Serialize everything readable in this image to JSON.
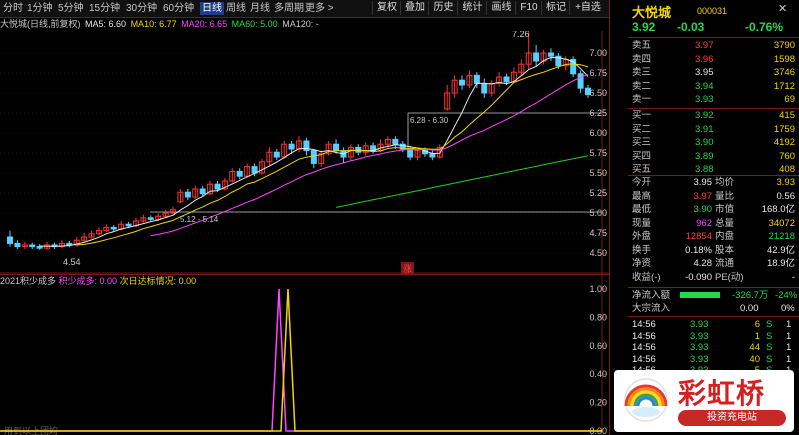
{
  "toolbar": {
    "periods": [
      "分时",
      "1分钟",
      "5分钟",
      "15分钟",
      "30分钟",
      "60分钟",
      "日线",
      "周线",
      "月线",
      "多周期",
      "更多 >"
    ],
    "buttons": [
      "复权",
      "叠加",
      "历史",
      "统计",
      "画线",
      "F10",
      "标记",
      "+自选"
    ]
  },
  "header": {
    "title": "大悦城(日线,前复权)",
    "ma5": "MA5: 6.60",
    "ma10": "MA10: 6.77",
    "ma20": "MA20: 6.65",
    "ma60": "MA60: 5.00",
    "ma120": "MA120: -"
  },
  "chart": {
    "price_labels": [
      "7.00",
      "6.75",
      "6.50",
      "6.25",
      "6.00",
      "5.75",
      "5.50",
      "5.25",
      "5.00",
      "4.75",
      "4.50"
    ],
    "ann_high": "7.26",
    "ann_low": "4.54",
    "ann_box1": "5.12 - 5.14",
    "ann_box2": "6.28 - 6.30",
    "marker": "涨",
    "ind_labels": [
      "1.00",
      "0.80",
      "0.60",
      "0.40",
      "0.20"
    ],
    "ind_low_label": "0.00",
    "watermark": "用到以上团均"
  },
  "indicator": {
    "name": "2021积少成多",
    "line1": "积少成多: 0.00",
    "line2": "次日达标情况: 0.00"
  },
  "stock": {
    "name": "大悦城",
    "code": "000031",
    "price": "3.92",
    "change": "-0.03",
    "pct": "-0.76%"
  },
  "asks": [
    {
      "label": "卖五",
      "price": "3.97",
      "vol": "3790"
    },
    {
      "label": "卖四",
      "price": "3.96",
      "vol": "1598"
    },
    {
      "label": "卖三",
      "price": "3.95",
      "vol": "3746"
    },
    {
      "label": "卖二",
      "price": "3.94",
      "vol": "1712"
    },
    {
      "label": "卖一",
      "price": "3.93",
      "vol": "69"
    }
  ],
  "bids": [
    {
      "label": "买一",
      "price": "3.92",
      "vol": "415"
    },
    {
      "label": "买二",
      "price": "3.91",
      "vol": "1759"
    },
    {
      "label": "买三",
      "price": "3.90",
      "vol": "4192"
    },
    {
      "label": "买四",
      "price": "3.89",
      "vol": "760"
    },
    {
      "label": "买五",
      "price": "3.88",
      "vol": "408"
    }
  ],
  "stats": [
    {
      "l1": "今开",
      "v1": "3.95",
      "l2": "均价",
      "v2": "3.93"
    },
    {
      "l1": "最高",
      "v1": "3.97",
      "l2": "量比",
      "v2": "0.56"
    },
    {
      "l1": "最低",
      "v1": "3.90",
      "l2": "市值",
      "v2": "168.0亿"
    },
    {
      "l1": "现量",
      "v1": "962",
      "l2": "总量",
      "v2": "34072"
    },
    {
      "l1": "外盘",
      "v1": "12854",
      "l2": "内盘",
      "v2": "21218"
    },
    {
      "l1": "换手",
      "v1": "0.18%",
      "l2": "股本",
      "v2": "42.9亿"
    },
    {
      "l1": "净资",
      "v1": "4.28",
      "l2": "流通",
      "v2": "18.9亿"
    },
    {
      "l1": "收益(-)",
      "v1": "-0.090",
      "l2": "PE(动)",
      "v2": "-"
    }
  ],
  "flow": {
    "l1": "净流入额",
    "v1": "-326.7万",
    "p1": "-24%",
    "l2": "大宗流入",
    "v2": "0.00",
    "p2": "0%"
  },
  "ticks": [
    {
      "t": "14:56",
      "p": "3.93",
      "v": "6",
      "s": "S",
      "n": "1"
    },
    {
      "t": "14:56",
      "p": "3.93",
      "v": "1",
      "s": "S",
      "n": "1"
    },
    {
      "t": "14:56",
      "p": "3.93",
      "v": "44",
      "s": "S",
      "n": "1"
    },
    {
      "t": "14:56",
      "p": "3.93",
      "v": "40",
      "s": "S",
      "n": "1"
    },
    {
      "t": "14:56",
      "p": "3.93",
      "v": "5",
      "s": "S",
      "n": "1"
    }
  ],
  "ad": {
    "brand": "彩虹桥",
    "sub": "投资充电站"
  },
  "colors": {
    "up": "#ff3232",
    "down": "#22d84b",
    "ma5": "#e8e8e8",
    "ma10": "#f2d600",
    "ma20": "#ff44ff",
    "ma60": "#22cc22"
  }
}
